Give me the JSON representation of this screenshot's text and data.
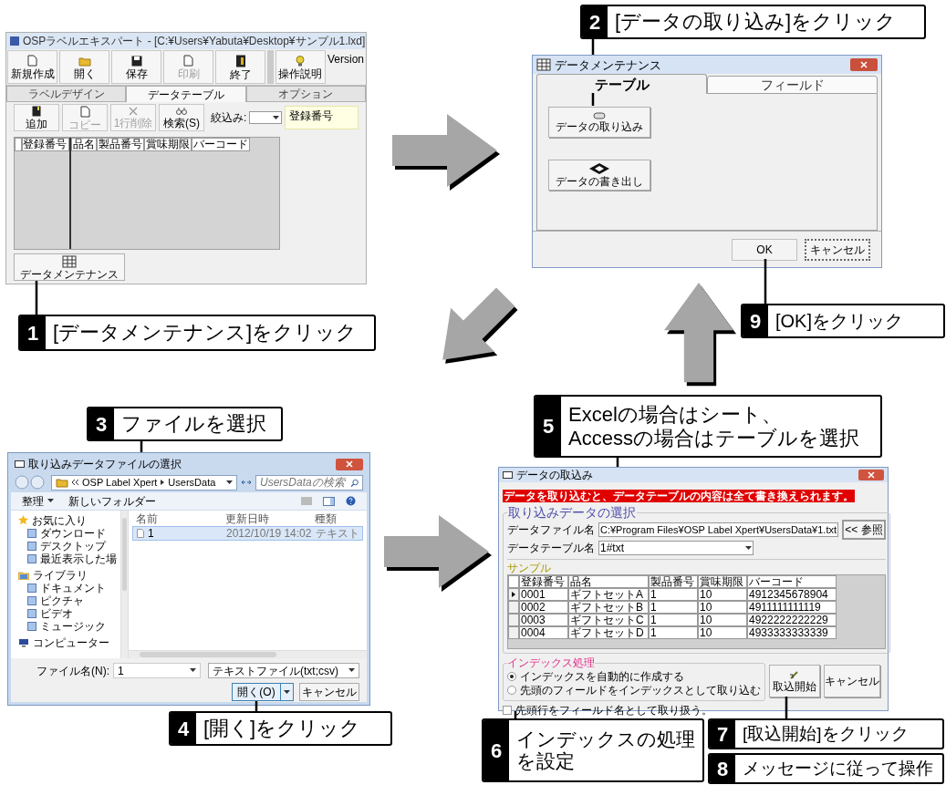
{
  "callouts": [
    {
      "number": "2",
      "lines": [
        "[データの取り込み]をクリック"
      ]
    },
    {
      "number": "1",
      "lines": [
        "[データメンテナンス]をクリック"
      ]
    },
    {
      "number": "9",
      "lines": [
        "[OK]をクリック"
      ]
    },
    {
      "number": "3",
      "lines": [
        "ファイルを選択"
      ]
    },
    {
      "number": "5",
      "lines": [
        "Excelの場合はシート、",
        "Accessの場合はテーブルを選択"
      ]
    },
    {
      "number": "4",
      "lines": [
        "[開く]をクリック"
      ]
    },
    {
      "number": "6",
      "lines": [
        "インデックスの処理",
        "を設定"
      ]
    },
    {
      "number": "7",
      "lines": [
        "[取込開始]をクリック"
      ]
    },
    {
      "number": "8",
      "lines": [
        "メッセージに従って操作"
      ]
    }
  ],
  "main_window": {
    "title": "OSPラベルエキスパート - [C:¥Users¥Yabuta¥Desktop¥サンプル1.lxd]",
    "toolbar": [
      {
        "label": "新規作成",
        "disabled": false
      },
      {
        "label": "開く",
        "disabled": false
      },
      {
        "label": "保存",
        "disabled": false
      },
      {
        "label": "印刷",
        "disabled": true
      },
      {
        "label": "終了",
        "disabled": false
      }
    ],
    "help_button": "操作説明",
    "version": "Version",
    "tabs": [
      {
        "label": "ラベルデザイン",
        "selected": false
      },
      {
        "label": "データテーブル",
        "selected": true
      },
      {
        "label": "オプション",
        "selected": false
      }
    ],
    "actions": [
      {
        "label": "追加",
        "disabled": false
      },
      {
        "label": "コピー",
        "disabled": true
      },
      {
        "label": "1行削除",
        "disabled": true
      },
      {
        "label": "検索(S)",
        "disabled": false
      }
    ],
    "filter_label": "絞込み:",
    "filter_box": "登録番号",
    "columns": [
      "登録番号",
      "品名",
      "製品番号",
      "賞味期限",
      "バーコード"
    ],
    "maintenance_button": "データメンテナンス"
  },
  "maintenance_dialog": {
    "title": "データメンテナンス",
    "tabs": [
      {
        "label": "テーブル",
        "selected": true
      },
      {
        "label": "フィールド",
        "selected": false
      }
    ],
    "actions": [
      "データの取り込み",
      "データの書き出し"
    ],
    "ok_button": "OK",
    "cancel_button": "キャンセル"
  },
  "file_dialog": {
    "title": "取り込みデータファイルの選択",
    "breadcrumb": [
      "OSP Label Xpert",
      "UsersData"
    ],
    "search_placeholder": "UsersDataの検索",
    "organize": "整理",
    "new_folder": "新しいフォルダー",
    "nav": [
      {
        "label": "お気に入り",
        "children": [
          {
            "label": "ダウンロード"
          },
          {
            "label": "デスクトップ"
          },
          {
            "label": "最近表示した場"
          }
        ]
      },
      {
        "label": "ライブラリ",
        "children": [
          {
            "label": "ドキュメント"
          },
          {
            "label": "ピクチャ"
          },
          {
            "label": "ビデオ"
          },
          {
            "label": "ミュージック"
          }
        ]
      },
      {
        "label": "コンピューター"
      }
    ],
    "columns": [
      "名前",
      "更新日時",
      "種類"
    ],
    "files": [
      {
        "cells": [
          "1",
          "2012/10/19 14:02",
          "テキスト"
        ],
        "selected": true
      }
    ],
    "filename_label": "ファイル名(N):",
    "filename": "1",
    "filter": "テキストファイル(txt;csv)",
    "open_button": "開く(O)",
    "cancel_button": "キャンセル"
  },
  "import_dialog": {
    "title": "データの取込み",
    "warning": "データを取り込むと、データテーブルの内容は全て書き換えられます。",
    "group_title": "取り込みデータの選択",
    "file_label": "データファイル名",
    "file_value": "C:¥Program Files¥OSP Label Xpert¥UsersData¥1.txt",
    "browse_button": "<< 参照",
    "table_label": "データテーブル名",
    "table_value": "1#txt",
    "sample_label": "サンプル",
    "columns": [
      "登録番号",
      "品名",
      "製品番号",
      "賞味期限",
      "バーコード"
    ],
    "rows": [
      {
        "cells": [
          "0001",
          "ギフトセットA",
          "1",
          "10",
          "4912345678904"
        ],
        "selected": true
      },
      {
        "cells": [
          "0002",
          "ギフトセットB",
          "1",
          "10",
          "4911111111119"
        ],
        "selected": false
      },
      {
        "cells": [
          "0003",
          "ギフトセットC",
          "1",
          "10",
          "4922222222229"
        ],
        "selected": false
      },
      {
        "cells": [
          "0004",
          "ギフトセットD",
          "1",
          "10",
          "4933333333339"
        ],
        "selected": false
      }
    ],
    "index_title": "インデックス処理",
    "index_options": [
      {
        "label": "インデックスを自動的に作成する",
        "selected": true
      },
      {
        "label": "先頭のフィールドをインデックスとして取り込む",
        "selected": false
      }
    ],
    "header_option": {
      "label": "先頭行をフィールド名として取り扱う。",
      "checked": false
    },
    "start_button": "取込開始",
    "cancel_button": "キャンセル"
  }
}
